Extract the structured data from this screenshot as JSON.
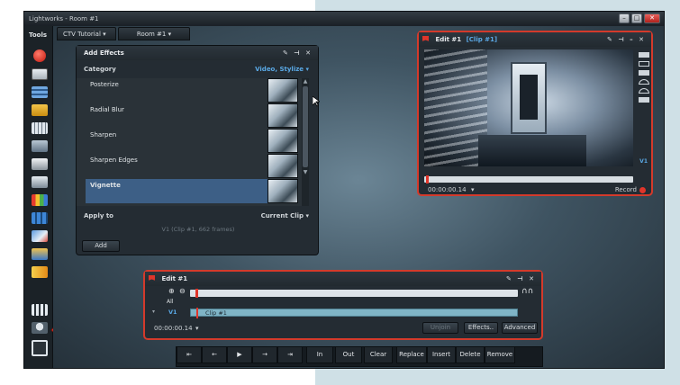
{
  "app": {
    "title": "Lightworks - Room #1",
    "window_buttons": {
      "minimize": "–",
      "maximize": "□",
      "close": "✕"
    }
  },
  "tools_label": "Tools",
  "tabs": [
    {
      "label": "CTV Tutorial ▾"
    },
    {
      "label": "Room #1 ▾"
    }
  ],
  "add_effects": {
    "title": "Add Effects",
    "controls": "✎ ⊣ ✕",
    "category_label": "Category",
    "category_value": "Video, Stylize ▾",
    "effects": [
      "Posterize",
      "Radial Blur",
      "Sharpen",
      "Sharpen Edges",
      "Vignette"
    ],
    "selected": "Vignette",
    "apply_to_label": "Apply to",
    "apply_to_value": "Current Clip ▾",
    "clip_info": "V1 (Clip #1, 662 frames)",
    "add_button": "Add"
  },
  "viewer": {
    "title": "Edit #1",
    "clip_label": "[Clip #1]",
    "controls": "✎ ⊣ – ✕",
    "timecode": "00:00:00.14",
    "timecode_menu": "▾",
    "record_label": "Record",
    "track_label": "V1"
  },
  "timeline": {
    "title": "Edit #1",
    "controls": "✎ ⊣ ✕",
    "all_label": "All",
    "track_label": "V1",
    "clip_label": "Clip #1",
    "timecode": "00:00:00.14",
    "timecode_menu": "▾",
    "buttons": {
      "unjoin": "Unjoin",
      "effects": "Effects..",
      "advanced": "Advanced"
    }
  },
  "transport": {
    "nav": [
      "⇤",
      "←",
      "▶",
      "→",
      "⇥"
    ],
    "edit_buttons": [
      "In",
      "Out",
      "Clear",
      "Replace",
      "Insert",
      "Delete",
      "Remove"
    ]
  },
  "colors": {
    "accent_red": "#d43a2b",
    "selection_blue": "#3d5f86",
    "category_blue": "#5aa9e6"
  }
}
